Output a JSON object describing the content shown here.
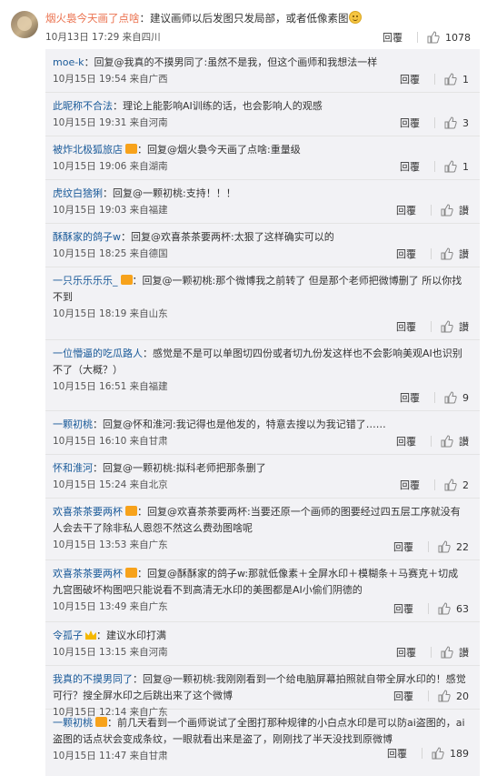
{
  "main_comment": {
    "user": "烟火裊今天画了点啥",
    "text": "：建议画师以后发图只发局部，或者低像素图",
    "time": "10月13日 17:29",
    "source": "来自四川",
    "reply_label": "回覆",
    "likes": "1078"
  },
  "replies": [
    {
      "user": "moe-k",
      "text": "：回复@我真的不摸男同了:虽然不是我，但这个画师和我想法一样",
      "time": "10月15日 19:54",
      "source": "来自广西",
      "reply_label": "回覆",
      "likes": "1"
    },
    {
      "user": "此昵称不合法",
      "text": "：理论上能影响AI训练的话，也会影响人的观感",
      "time": "10月15日 19:31",
      "source": "来自河南",
      "reply_label": "回覆",
      "likes": "3"
    },
    {
      "user": "被炸北极狐旅店",
      "text": "：回复@烟火裊今天画了点啥:重量级",
      "time": "10月15日 19:06",
      "source": "来自湖南",
      "reply_label": "回覆",
      "likes": "1"
    },
    {
      "user": "虎纹白猞猁",
      "text": "：回复@一颗初桃:支持！！！",
      "time": "10月15日 19:03",
      "source": "来自福建",
      "reply_label": "回覆",
      "likes": "讃"
    },
    {
      "user": "酥酥家的鸽子w",
      "text": "：回复@欢喜茶茶要两杯:太狠了这样确实可以的",
      "time": "10月15日 18:25",
      "source": "来自德国",
      "reply_label": "回覆",
      "likes": "讃"
    },
    {
      "user": "一只乐乐乐乐_",
      "text": "：回复@一颗初桃:那个微博我之前转了 但是那个老师把微博删了 所以你找不到",
      "time": "10月15日 18:19",
      "source": "来自山东",
      "reply_label": "回覆",
      "likes": "讃"
    },
    {
      "user": "一位懵逼的吃瓜路人",
      "text": "：感觉是不是可以单图切四份或者切九份发这样也不会影响美观AI也识别不了（大概？）",
      "time": "10月15日 16:51",
      "source": "来自福建",
      "reply_label": "回覆",
      "likes": "9"
    },
    {
      "user": "一颗初桃",
      "text": "：回复@怀和淮河:我记得也是他发的，特意去搜以为我记错了……",
      "time": "10月15日 16:10",
      "source": "来自甘肃",
      "reply_label": "回覆",
      "likes": "讃"
    },
    {
      "user": "怀和淮河",
      "text": "：回复@一颗初桃:拟科老师把那条删了",
      "time": "10月15日 15:24",
      "source": "来自北京",
      "reply_label": "回覆",
      "likes": "2"
    },
    {
      "user": "欢喜茶茶要两杯",
      "text": "：回复@欢喜茶茶要两杯:当要还原一个画师的图要经过四五层工序就没有人会去干了除非私人恩怨不然这么费劲图啥呢",
      "time": "10月15日 13:53",
      "source": "来自广东",
      "reply_label": "回覆",
      "likes": "22"
    },
    {
      "user": "欢喜茶茶要两杯",
      "text": "：回复@酥酥家的鸽子w:那就低像素＋全屏水印＋模糊条＋马赛克＋切成九宫图破坏构图吧只能说看不到高清无水印的美图都是AI小偷们阴德的",
      "time": "10月15日 13:49",
      "source": "来自广东",
      "reply_label": "回覆",
      "likes": "63"
    },
    {
      "user": "令孤子",
      "text": "：建议水印打满",
      "time": "10月15日 13:15",
      "source": "来自河南",
      "reply_label": "回覆",
      "likes": "讃"
    },
    {
      "user": "我真的不摸男同了",
      "text": "：回复@一颗初桃:我刚刚看到一个给电脑屏幕拍照就自带全屏水印的！感觉可行？搜全屏水印之后跳出来了这个微博",
      "time": "10月15日 12:14",
      "source": "来自广东",
      "reply_label": "回覆",
      "likes": "20"
    },
    {
      "user": "一颗初桃",
      "text": "：前几天看到一个画师说试了全图打那种规律的小白点水印是可以防ai盗图的，ai盗图的话点状会变成条纹，一眼就看出来是盗了，刚刚找了半天没找到原微博",
      "time": "10月15日 11:47",
      "source": "来自甘肃",
      "reply_label": "回覆",
      "likes": "189"
    }
  ]
}
